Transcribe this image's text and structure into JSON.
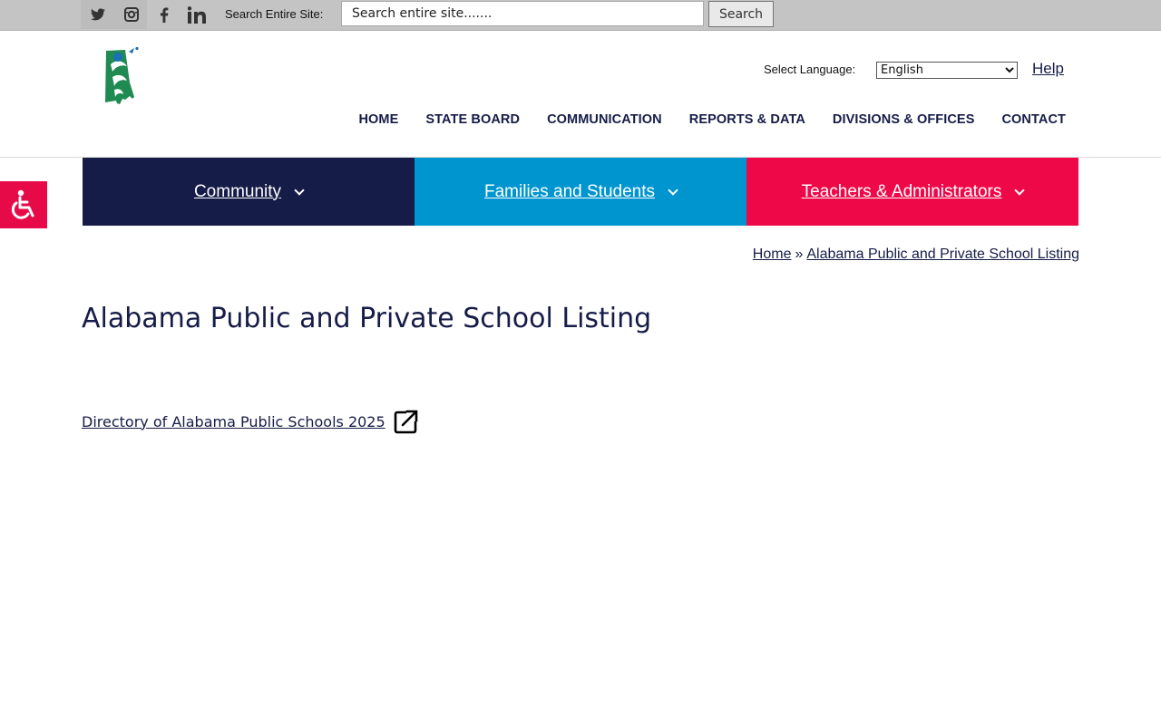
{
  "topbar": {
    "social": [
      {
        "name": "twitter",
        "icon": "twitter-icon"
      },
      {
        "name": "instagram",
        "icon": "instagram-icon"
      },
      {
        "name": "facebook",
        "icon": "facebook-icon"
      },
      {
        "name": "linkedin",
        "icon": "linkedin-icon"
      }
    ],
    "search_label": "Search Entire Site:",
    "search_placeholder": "Search entire site.......",
    "search_button": "Search"
  },
  "header": {
    "logo_icon": "alabama-state-logo",
    "language_label": "Select Language:",
    "language_selected": "English",
    "help_label": "Help",
    "nav": [
      "HOME",
      "STATE BOARD",
      "COMMUNICATION",
      "REPORTS & DATA",
      "DIVISIONS & OFFICES",
      "CONTACT"
    ]
  },
  "audience": {
    "items": [
      {
        "label": "Community",
        "color": "#161c48"
      },
      {
        "label": "Families and Students",
        "color": "#0095cf"
      },
      {
        "label": "Teachers & Administrators",
        "color": "#ef0848"
      }
    ]
  },
  "accessibility": {
    "icon": "wheelchair-icon",
    "color": "#e60a48"
  },
  "breadcrumb": {
    "home": "Home",
    "separator": "»",
    "current": "Alabama Public and Private School Listing"
  },
  "main": {
    "title": "Alabama Public and Private School Listing",
    "directory_link": "Directory of Alabama Public Schools 2025",
    "directory_icon": "external-link-icon"
  },
  "colors": {
    "navy": "#161c48",
    "blue": "#0095cf",
    "red": "#ef0848",
    "topbar": "#c4c4c4"
  }
}
